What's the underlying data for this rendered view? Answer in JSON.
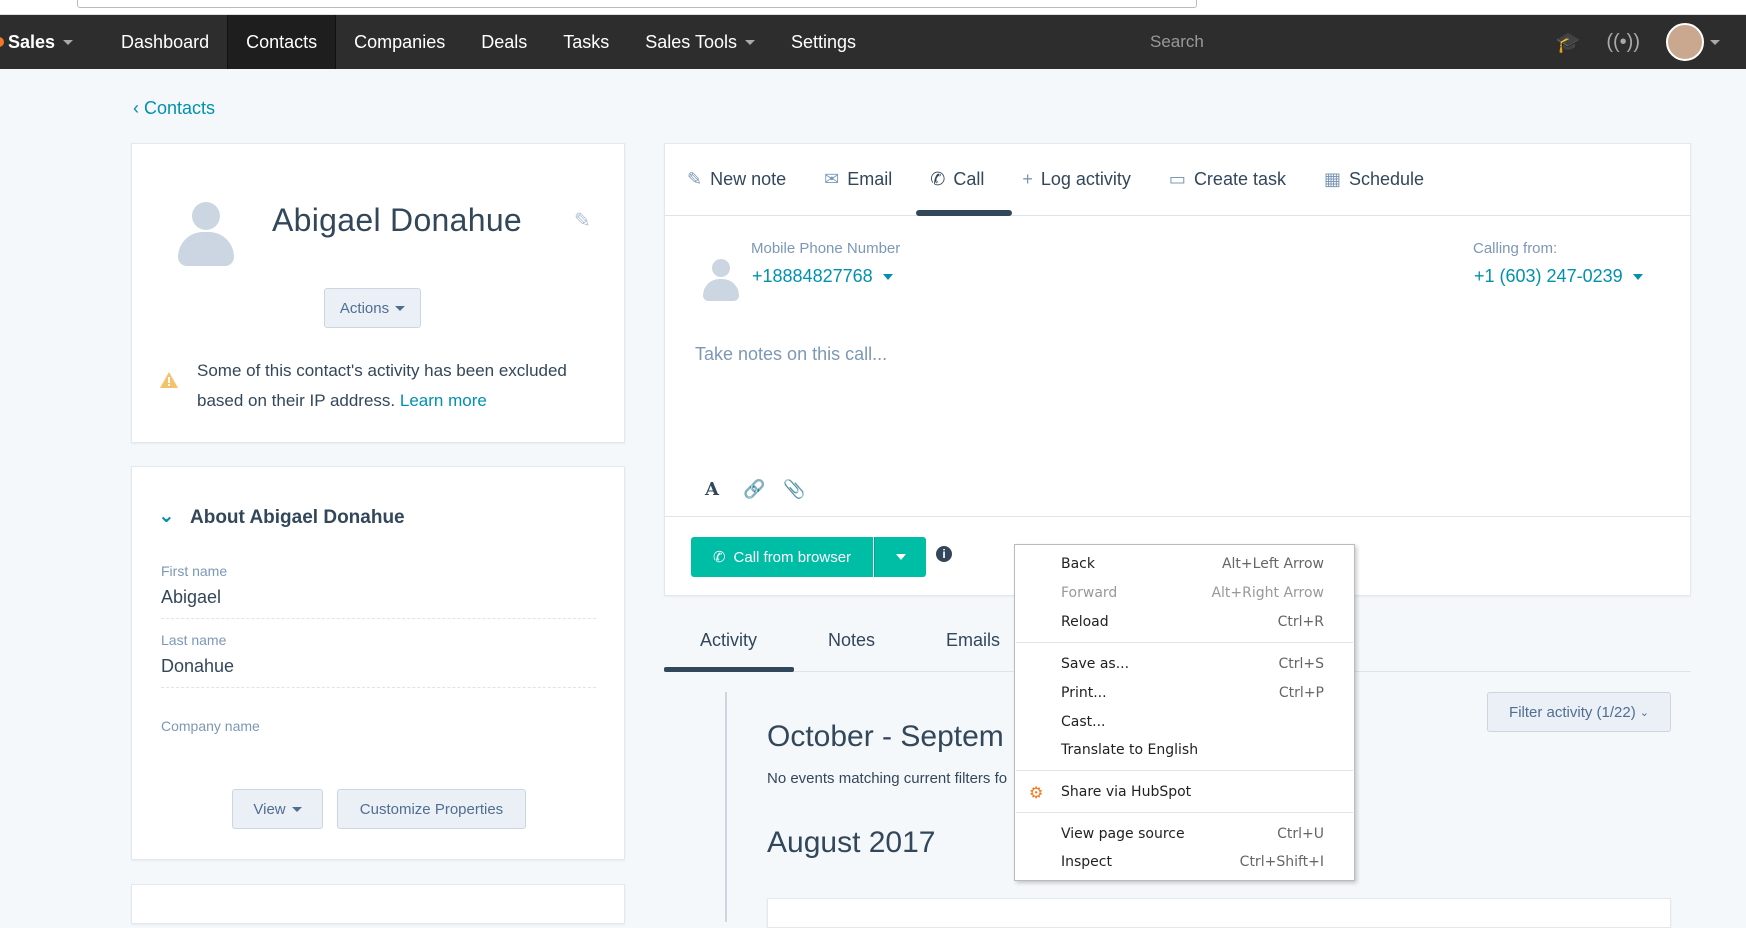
{
  "nav": {
    "brand": "Sales",
    "items": [
      {
        "label": "Dashboard"
      },
      {
        "label": "Contacts"
      },
      {
        "label": "Companies"
      },
      {
        "label": "Deals"
      },
      {
        "label": "Tasks"
      },
      {
        "label": "Sales Tools"
      },
      {
        "label": "Settings"
      }
    ],
    "search_placeholder": "Search"
  },
  "breadcrumb": {
    "back_label": "Contacts"
  },
  "contact": {
    "name": "Abigael Donahue",
    "actions_label": "Actions",
    "warning_text": "Some of this contact's activity has been excluded based on their IP address.",
    "warning_link": "Learn more"
  },
  "about": {
    "title": "About Abigael Donahue",
    "first_name_label": "First name",
    "first_name_value": "Abigael",
    "last_name_label": "Last name",
    "last_name_value": "Donahue",
    "company_label": "Company name",
    "view_label": "View",
    "customize_label": "Customize Properties"
  },
  "tabs": [
    {
      "label": "New note",
      "icon": "edit-icon"
    },
    {
      "label": "Email",
      "icon": "envelope-icon"
    },
    {
      "label": "Call",
      "icon": "phone-icon"
    },
    {
      "label": "Log activity",
      "icon": "plus-icon"
    },
    {
      "label": "Create task",
      "icon": "monitor-icon"
    },
    {
      "label": "Schedule",
      "icon": "calendar-icon"
    }
  ],
  "call": {
    "mobile_label": "Mobile Phone Number",
    "mobile_value": "+18884827768",
    "calling_from_label": "Calling from:",
    "calling_from_value": "+1 (603) 247-0239",
    "notes_placeholder": "Take notes on this call...",
    "call_button": "Call from browser",
    "accent": "#00bda5"
  },
  "activity": {
    "tabs": [
      "Activity",
      "Notes",
      "Emails"
    ],
    "filter_label": "Filter activity (1/22)",
    "period1": "October - Septem",
    "no_events": "No events matching current filters fo",
    "period2": "August 2017"
  },
  "context_menu": {
    "items": [
      {
        "label": "Back",
        "shortcut": "Alt+Left Arrow"
      },
      {
        "label": "Forward",
        "shortcut": "Alt+Right Arrow"
      },
      {
        "label": "Reload",
        "shortcut": "Ctrl+R"
      },
      {
        "label": "Save as...",
        "shortcut": "Ctrl+S"
      },
      {
        "label": "Print...",
        "shortcut": "Ctrl+P"
      },
      {
        "label": "Cast...",
        "shortcut": ""
      },
      {
        "label": "Translate to English",
        "shortcut": ""
      },
      {
        "label": "Share via HubSpot",
        "shortcut": ""
      },
      {
        "label": "View page source",
        "shortcut": "Ctrl+U"
      },
      {
        "label": "Inspect",
        "shortcut": "Ctrl+Shift+I"
      }
    ]
  }
}
